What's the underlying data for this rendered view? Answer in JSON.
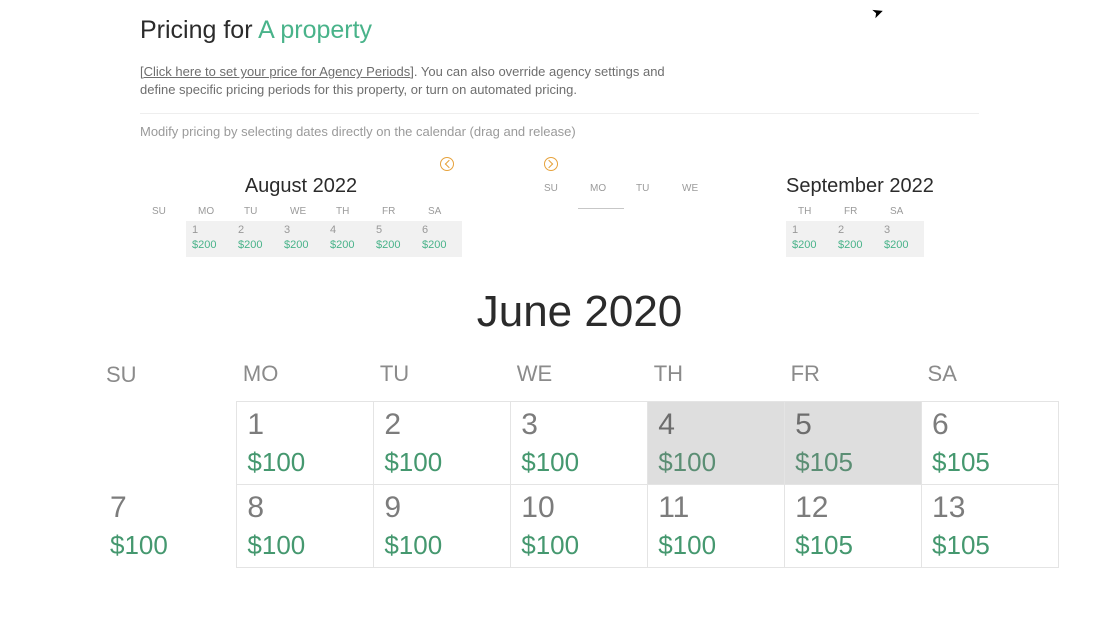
{
  "header": {
    "title_prefix": "Pricing for ",
    "title_accent": "A property",
    "link_text": "Click here to set your price for Agency Periods",
    "subtitle_rest": ". You can also override agency settings and define specific pricing periods for this property, or turn on automated pricing.",
    "hint": "Modify pricing by selecting dates directly on the calendar (drag and release)"
  },
  "weekday_short": [
    "SU",
    "MO",
    "TU",
    "WE",
    "TH",
    "FR",
    "SA"
  ],
  "mini": [
    {
      "title": "August 2022",
      "lead_blanks": 1,
      "days": [
        {
          "n": "1",
          "p": "$200"
        },
        {
          "n": "2",
          "p": "$200"
        },
        {
          "n": "3",
          "p": "$200"
        },
        {
          "n": "4",
          "p": "$200"
        },
        {
          "n": "5",
          "p": "$200"
        },
        {
          "n": "6",
          "p": "$200"
        }
      ]
    },
    {
      "title": "",
      "lead_blanks": 1,
      "days": [],
      "bottom_line_col": 1
    },
    {
      "title": "September 2022",
      "lead_blanks": 4,
      "days": [
        {
          "n": "1",
          "p": "$200"
        },
        {
          "n": "2",
          "p": "$200"
        },
        {
          "n": "3",
          "p": "$200"
        }
      ]
    }
  ],
  "large": {
    "title": "June 2020",
    "rows": [
      [
        {
          "blank": true
        },
        {
          "n": "1",
          "p": "$100"
        },
        {
          "n": "2",
          "p": "$100"
        },
        {
          "n": "3",
          "p": "$100"
        },
        {
          "n": "4",
          "p": "$100",
          "shade": true
        },
        {
          "n": "5",
          "p": "$105",
          "shade": true
        },
        {
          "n": "6",
          "p": "$105"
        }
      ],
      [
        {
          "n": "7",
          "p": "$100",
          "noborder": true
        },
        {
          "n": "8",
          "p": "$100"
        },
        {
          "n": "9",
          "p": "$100"
        },
        {
          "n": "10",
          "p": "$100"
        },
        {
          "n": "11",
          "p": "$100"
        },
        {
          "n": "12",
          "p": "$105"
        },
        {
          "n": "13",
          "p": "$105"
        }
      ]
    ]
  }
}
